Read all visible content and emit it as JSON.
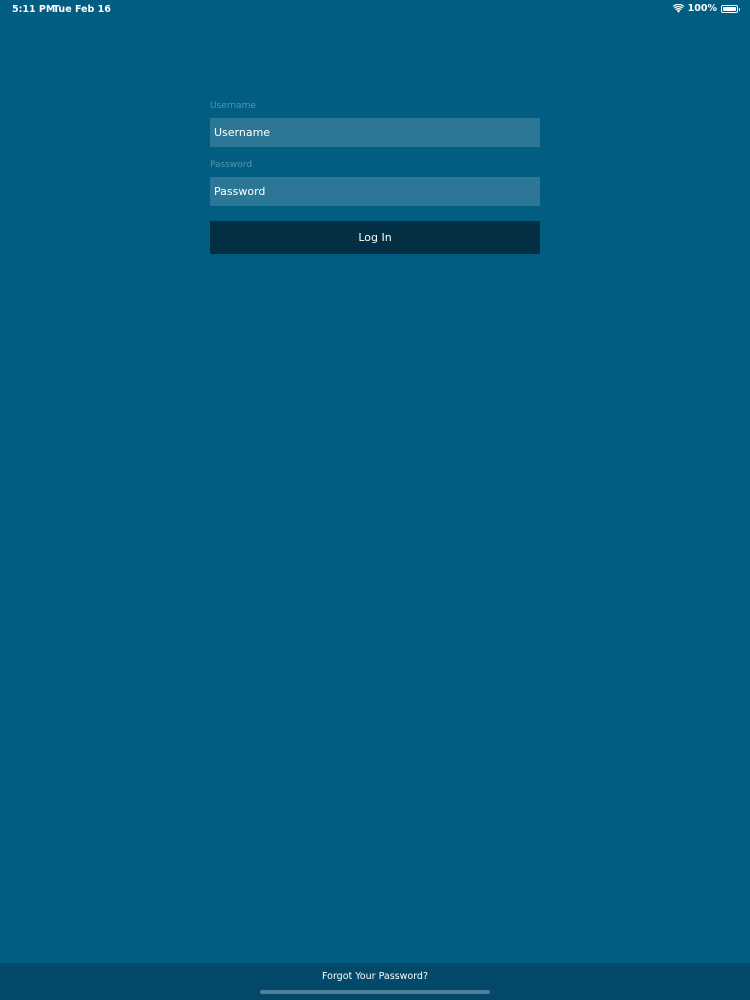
{
  "status_bar": {
    "time": "5:11 PM",
    "date": "Tue Feb 16",
    "battery_text": "100%",
    "icons": [
      "wifi-icon",
      "battery-icon"
    ]
  },
  "login_form": {
    "username_label": "Username",
    "username_placeholder": "Username",
    "username_value": "",
    "password_label": "Password",
    "password_placeholder": "Password",
    "password_value": "",
    "login_button_label": "Log In"
  },
  "footer": {
    "forgot_password_label": "Forgot Your Password?"
  },
  "colors": {
    "background": "#025d83",
    "input_background": "#2c7796",
    "button_background": "#022f44",
    "footer_background": "#02496a",
    "label_color": "#5a93ad",
    "text_color": "#ffffff"
  }
}
